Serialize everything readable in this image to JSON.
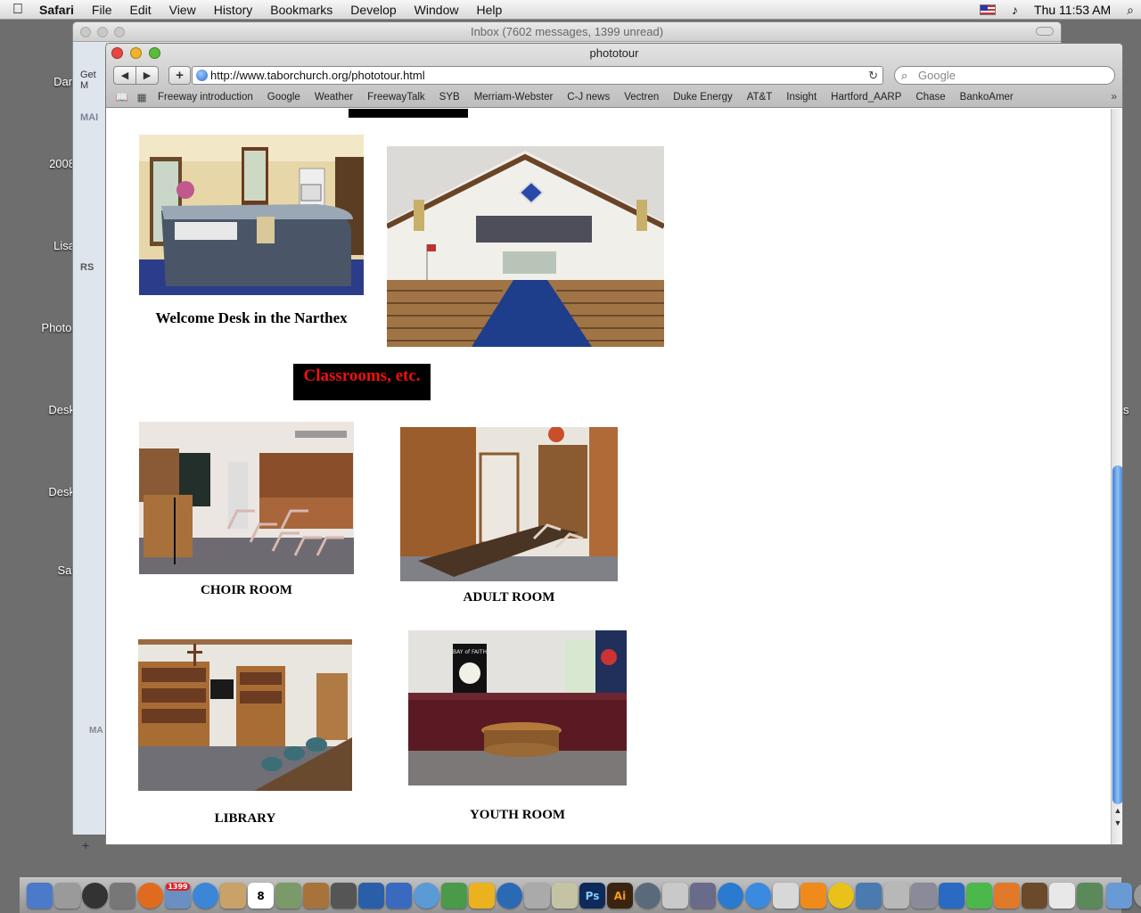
{
  "menubar": {
    "apple": "",
    "items": [
      "Safari",
      "File",
      "Edit",
      "View",
      "History",
      "Bookmarks",
      "Develop",
      "Window",
      "Help"
    ],
    "clock": "Thu 11:53 AM",
    "volume_icon": "♪",
    "spotlight_icon": "⌕"
  },
  "desktop": {
    "labels": [
      "Darl",
      "2008",
      "Lisa",
      "Photo:",
      "Desk",
      "Desk",
      "Saf"
    ],
    "right_label": "s"
  },
  "mail_window": {
    "title": "Inbox (7602 messages, 1399 unread)",
    "get_mail": "Get M",
    "section_mail": "MAI",
    "section_rss": "RS",
    "section_ma": "MA",
    "add": "+"
  },
  "safari": {
    "title": "phototour",
    "url": "http://www.taborchurch.org/phototour.html",
    "search_placeholder": "Google",
    "bookmarks": [
      "Freeway introduction",
      "Google",
      "Weather",
      "FreewayTalk",
      "SYB",
      "Merriam-Webster",
      "C-J news",
      "Vectren",
      "Duke Energy",
      "AT&T",
      "Insight",
      "Hartford_AARP",
      "Chase",
      "BankoAmer"
    ],
    "more": "»"
  },
  "page": {
    "narthex_caption": "Welcome Desk in the Narthex",
    "section_header": "Classrooms, etc.",
    "choir_caption": "CHOIR ROOM",
    "adult_caption": "ADULT ROOM",
    "library_caption": "LIBRARY",
    "youth_caption": "YOUTH ROOM",
    "youth_banner": "BAY of FAITH"
  },
  "dock": {
    "mail_badge": "1399",
    "ical_day": "8",
    "ps": "Ps",
    "ai": "Ai"
  }
}
